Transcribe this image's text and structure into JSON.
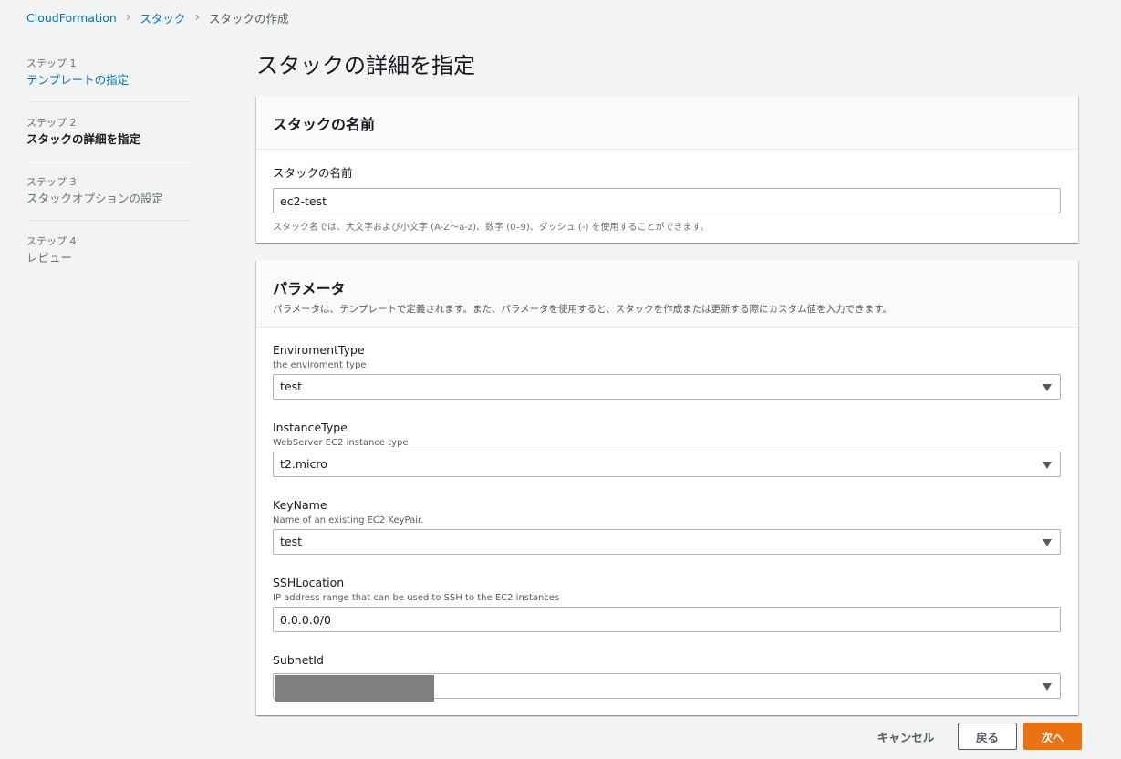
{
  "breadcrumb": {
    "root": "CloudFormation",
    "stacks": "スタック",
    "current": "スタックの作成"
  },
  "steps": [
    {
      "num": "ステップ 1",
      "label": "テンプレートの指定",
      "state": "link"
    },
    {
      "num": "ステップ 2",
      "label": "スタックの詳細を指定",
      "state": "active"
    },
    {
      "num": "ステップ 3",
      "label": "スタックオプションの設定",
      "state": "disabled"
    },
    {
      "num": "ステップ 4",
      "label": "レビュー",
      "state": "disabled"
    }
  ],
  "page_title": "スタックの詳細を指定",
  "stack_name_panel": {
    "title": "スタックの名前",
    "field_label": "スタックの名前",
    "value": "ec2-test",
    "hint": "スタック名では、大文字および小文字 (A-Z〜a-z)、数字 (0–9)、ダッシュ (-) を使用することができます。"
  },
  "parameters_panel": {
    "title": "パラメータ",
    "description": "パラメータは、テンプレートで定義されます。また、パラメータを使用すると、スタックを作成または更新する際にカスタム値を入力できます。",
    "params": [
      {
        "label": "EnviromentType",
        "desc": "the enviroment type",
        "value": "test",
        "kind": "select"
      },
      {
        "label": "InstanceType",
        "desc": "WebServer EC2 instance type",
        "value": "t2.micro",
        "kind": "select"
      },
      {
        "label": "KeyName",
        "desc": "Name of an existing EC2 KeyPair.",
        "value": "test",
        "kind": "select"
      },
      {
        "label": "SSHLocation",
        "desc": "IP address range that can be used to SSH to the EC2 instances",
        "value": "0.0.0.0/0",
        "kind": "input"
      },
      {
        "label": "SubnetId",
        "desc": "",
        "value": "",
        "kind": "select-redacted"
      }
    ]
  },
  "footer": {
    "cancel": "キャンセル",
    "back": "戻る",
    "next": "次へ"
  },
  "colors": {
    "link": "#0073bb",
    "primary_button": "#ec7211",
    "background": "#f2f3f3"
  }
}
